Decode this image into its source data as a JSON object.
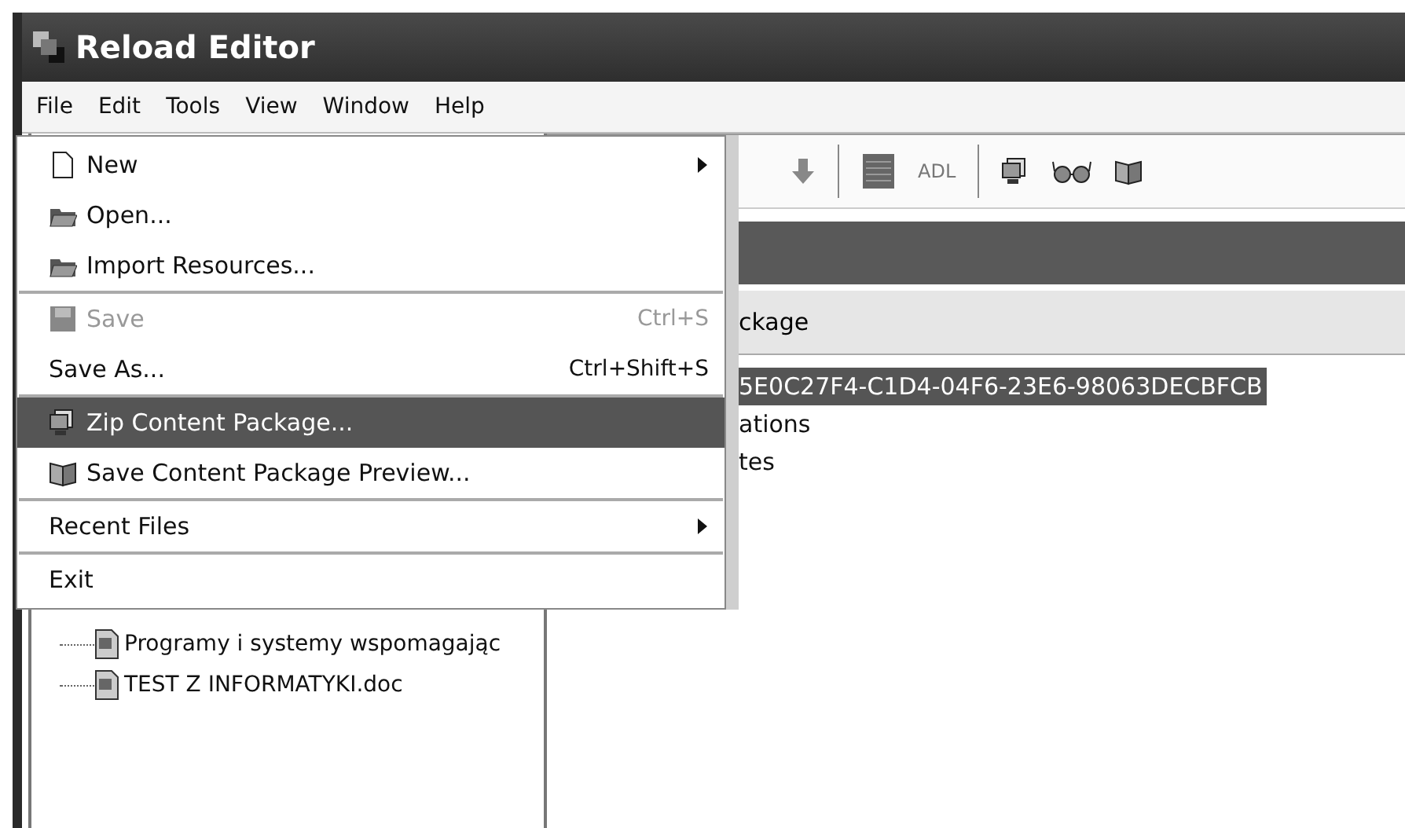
{
  "window": {
    "title": "Reload Editor"
  },
  "menubar": [
    {
      "label": "File"
    },
    {
      "label": "Edit"
    },
    {
      "label": "Tools"
    },
    {
      "label": "View"
    },
    {
      "label": "Window"
    },
    {
      "label": "Help"
    }
  ],
  "file_menu": [
    {
      "kind": "item",
      "label": "New",
      "submenu": true,
      "disabled": false,
      "selected": false
    },
    {
      "kind": "item",
      "label": "Open...",
      "submenu": false,
      "disabled": false,
      "selected": false
    },
    {
      "kind": "item",
      "label": "Import Resources...",
      "submenu": false,
      "disabled": false,
      "selected": false
    },
    {
      "kind": "separator"
    },
    {
      "kind": "item",
      "label": "Save",
      "shortcut": "Ctrl+S",
      "submenu": false,
      "disabled": true,
      "selected": false
    },
    {
      "kind": "item",
      "label": "Save As...",
      "shortcut": "Ctrl+Shift+S",
      "submenu": false,
      "disabled": false,
      "selected": false
    },
    {
      "kind": "separator"
    },
    {
      "kind": "item",
      "label": "Zip Content Package...",
      "submenu": false,
      "disabled": false,
      "selected": true
    },
    {
      "kind": "item",
      "label": "Save Content Package Preview...",
      "submenu": false,
      "disabled": false,
      "selected": false
    },
    {
      "kind": "separator"
    },
    {
      "kind": "item",
      "label": "Recent Files",
      "submenu": true,
      "disabled": false,
      "selected": false
    },
    {
      "kind": "separator"
    },
    {
      "kind": "item",
      "label": "Exit",
      "submenu": false,
      "disabled": false,
      "selected": false
    }
  ],
  "toolbar": {
    "adl_label": "ADL"
  },
  "content_panel": {
    "header": "ckage",
    "tree": [
      {
        "label": "5E0C27F4-C1D4-04F6-23E6-98063DECBFCB",
        "selected": true
      },
      {
        "label": "ations",
        "selected": false
      },
      {
        "label": "tes",
        "selected": false
      }
    ]
  },
  "file_tree": [
    {
      "label": "Programy i systemy wspomagając"
    },
    {
      "label": "TEST Z INFORMATYKI.doc"
    }
  ]
}
